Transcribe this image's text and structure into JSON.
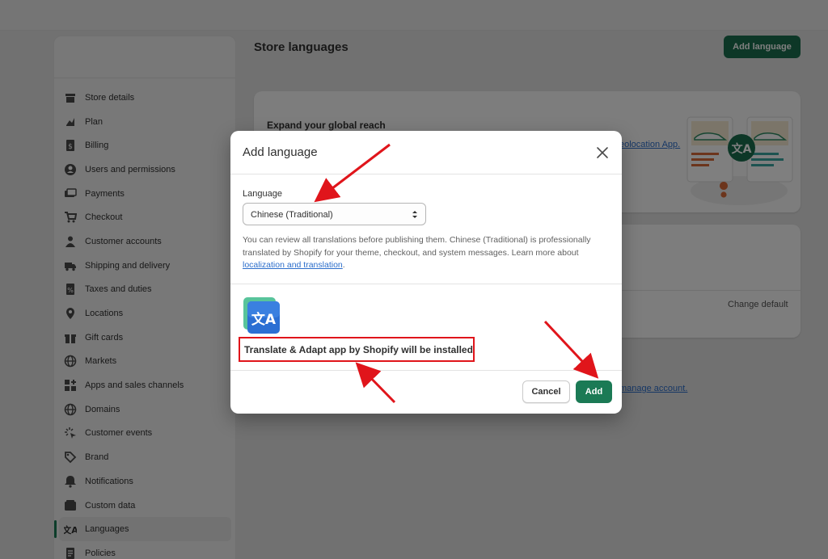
{
  "page": {
    "title": "Store languages",
    "add_language_button": "Add language",
    "expand_card_title": "Expand your global reach",
    "change_default_link": "Change default",
    "geolocation_link_partial": "eolocation App.",
    "manage_account_link_partial": "manage account."
  },
  "sidebar": {
    "items": [
      {
        "label": "Store details",
        "icon": "store-icon"
      },
      {
        "label": "Plan",
        "icon": "plan-icon"
      },
      {
        "label": "Billing",
        "icon": "billing-icon"
      },
      {
        "label": "Users and permissions",
        "icon": "user-icon"
      },
      {
        "label": "Payments",
        "icon": "payments-icon"
      },
      {
        "label": "Checkout",
        "icon": "cart-icon"
      },
      {
        "label": "Customer accounts",
        "icon": "person-icon"
      },
      {
        "label": "Shipping and delivery",
        "icon": "truck-icon"
      },
      {
        "label": "Taxes and duties",
        "icon": "tax-icon"
      },
      {
        "label": "Locations",
        "icon": "location-pin-icon"
      },
      {
        "label": "Gift cards",
        "icon": "gift-icon"
      },
      {
        "label": "Markets",
        "icon": "globe-icon"
      },
      {
        "label": "Apps and sales channels",
        "icon": "apps-icon"
      },
      {
        "label": "Domains",
        "icon": "globe-icon"
      },
      {
        "label": "Customer events",
        "icon": "cursor-icon"
      },
      {
        "label": "Brand",
        "icon": "brand-icon"
      },
      {
        "label": "Notifications",
        "icon": "bell-icon"
      },
      {
        "label": "Custom data",
        "icon": "data-icon"
      },
      {
        "label": "Languages",
        "icon": "language-icon",
        "active": true
      },
      {
        "label": "Policies",
        "icon": "policy-icon"
      }
    ]
  },
  "modal": {
    "title": "Add language",
    "field_label": "Language",
    "selected_language": "Chinese (Traditional)",
    "help_text": "You can review all translations before publishing them. Chinese (Traditional) is professionally translated by Shopify for your theme, checkout, and system messages. Learn more about ",
    "help_link": "localization and translation",
    "help_period": ".",
    "install_notice": "Translate & Adapt app by Shopify will be installed",
    "cancel_label": "Cancel",
    "add_label": "Add"
  },
  "colors": {
    "primary_green": "#1b7a55",
    "annotation_red": "#e0151b",
    "link_blue": "#2c6ecb"
  }
}
